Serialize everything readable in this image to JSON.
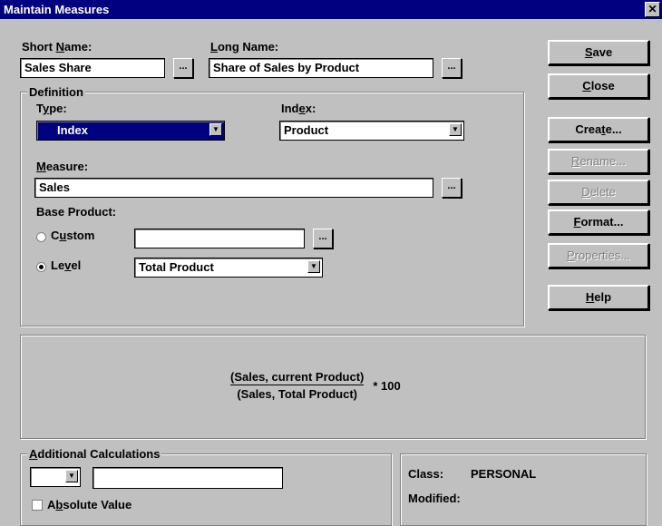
{
  "window": {
    "title": "Maintain Measures",
    "close_glyph": "✕"
  },
  "short_name": {
    "label_pre": "Short ",
    "label_ul": "N",
    "label_post": "ame:",
    "value": "Sales Share"
  },
  "long_name": {
    "label_pre": "",
    "label_ul": "L",
    "label_post": "ong Name:",
    "value": "Share of Sales by Product"
  },
  "ellipsis": "...",
  "definition": {
    "title": "Definition",
    "type": {
      "label_pre": "T",
      "label_ul": "y",
      "label_post": "pe:",
      "value": "Index"
    },
    "index": {
      "label_pre": "Ind",
      "label_ul": "e",
      "label_post": "x:",
      "value": "Product"
    },
    "measure": {
      "label_pre": "",
      "label_ul": "M",
      "label_post": "easure:",
      "value": "Sales"
    },
    "base_product": {
      "label": "Base Product:",
      "custom": {
        "label_pre": "C",
        "label_ul": "u",
        "label_post": "stom",
        "value": "",
        "selected": false
      },
      "level": {
        "label_pre": "Le",
        "label_ul": "v",
        "label_post": "el",
        "value": "Total Product",
        "selected": true
      }
    }
  },
  "buttons": {
    "save": {
      "pre": "",
      "ul": "S",
      "post": "ave"
    },
    "close": {
      "pre": "",
      "ul": "C",
      "post": "lose"
    },
    "create": {
      "pre": "Crea",
      "ul": "t",
      "post": "e..."
    },
    "rename": {
      "pre": "",
      "ul": "R",
      "post": "ename..."
    },
    "delete": {
      "pre": "",
      "ul": "D",
      "post": "elete"
    },
    "format": {
      "pre": "",
      "ul": "F",
      "post": "ormat..."
    },
    "properties": {
      "pre": "",
      "ul": "P",
      "post": "roperties..."
    },
    "help": {
      "pre": "",
      "ul": "H",
      "post": "elp"
    }
  },
  "formula": {
    "numerator": "(Sales, current Product)",
    "denominator": "(Sales, Total Product)",
    "multiplier": "* 100"
  },
  "additional": {
    "title_pre": "",
    "title_ul": "A",
    "title_post": "dditional Calculations",
    "operator_value": "",
    "operand_value": "",
    "absolute": {
      "label_pre": "A",
      "label_ul": "b",
      "label_post": "solute Value",
      "checked": false
    }
  },
  "info": {
    "class_label": "Class:",
    "class_value": "PERSONAL",
    "modified_label": "Modified:"
  },
  "dropdown_glyph": "▼"
}
